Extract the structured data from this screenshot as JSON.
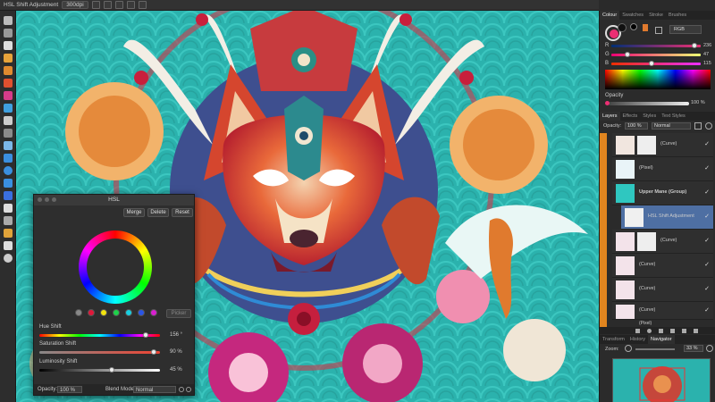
{
  "context_toolbar": {
    "layer_name": "HSL Shift Adjustment",
    "dpi": "300dpi"
  },
  "hsl_dialog": {
    "title": "HSL",
    "merge_label": "Merge",
    "delete_label": "Delete",
    "reset_label": "Reset",
    "picker_label": "Picker",
    "hue_label": "Hue Shift",
    "hue_value": "156 °",
    "hue_level": 0.88,
    "saturation_label": "Saturation Shift",
    "saturation_value": "90 %",
    "saturation_level": 0.95,
    "luminosity_label": "Luminosity Shift",
    "luminosity_value": "45 %",
    "luminosity_level": 0.6,
    "opacity_label": "Opacity:",
    "opacity_value": "100 %",
    "blend_label": "Blend Mode:",
    "blend_value": "Normal",
    "swatches": [
      "#888888",
      "#e0183a",
      "#f2e40f",
      "#1ed24a",
      "#18cfe0",
      "#2a55e6",
      "#d91fd1"
    ]
  },
  "colour_panel": {
    "tabs": [
      "Colour",
      "Swatches",
      "Stroke",
      "Brushes"
    ],
    "model": "RGB",
    "r_label": "R",
    "r_value": "236",
    "r_level": 0.93,
    "g_label": "G",
    "g_value": "47",
    "g_level": 0.18,
    "b_label": "B",
    "b_value": "115",
    "b_level": 0.45,
    "opacity_label": "Opacity",
    "opacity_value": "100 %",
    "current_color": "#ec2f73"
  },
  "layers_panel": {
    "tabs": [
      "Layers",
      "Effects",
      "Styles",
      "Text Styles"
    ],
    "opacity_label": "Opacity:",
    "opacity_value": "100 %",
    "blend_value": "Normal",
    "layers": [
      {
        "name": "(Curve)"
      },
      {
        "name": "(Pixel)"
      },
      {
        "name": "Upper Mane (Group)"
      },
      {
        "name": "HSL Shift Adjustment"
      },
      {
        "name": "(Curve)"
      },
      {
        "name": "(Curve)"
      },
      {
        "name": "(Curve)"
      },
      {
        "name": "(Curve)"
      },
      {
        "name": "(Pixel)"
      }
    ]
  },
  "navigator_panel": {
    "tabs": [
      "Transform",
      "History",
      "Navigator"
    ],
    "zoom_label": "Zoom:",
    "zoom_value": "33 %"
  }
}
